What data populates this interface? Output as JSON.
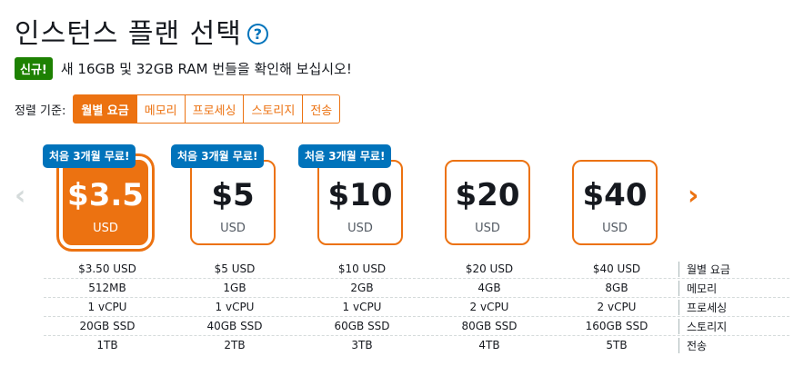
{
  "header": {
    "title": "인스턴스 플랜 선택",
    "help_icon": "?"
  },
  "notice": {
    "badge": "신규!",
    "text": "새 16GB 및 32GB RAM 번들을 확인해 보십시오!"
  },
  "sort": {
    "label": "정렬 기준:",
    "options": [
      "월별 요금",
      "메모리",
      "프로세싱",
      "스토리지",
      "전송"
    ],
    "selected": "월별 요금"
  },
  "nav": {
    "prev_icon": "chevron-left-icon",
    "next_icon": "chevron-right-icon",
    "prev_glyph": "‹",
    "next_glyph": "›"
  },
  "plans": [
    {
      "price": "$3.5",
      "currency": "USD",
      "promo": "처음 3개월 무료!",
      "selected": true,
      "specs": [
        "$3.50 USD",
        "512MB",
        "1 vCPU",
        "20GB SSD",
        "1TB"
      ]
    },
    {
      "price": "$5",
      "currency": "USD",
      "promo": "처음 3개월 무료!",
      "selected": false,
      "specs": [
        "$5 USD",
        "1GB",
        "1 vCPU",
        "40GB SSD",
        "2TB"
      ]
    },
    {
      "price": "$10",
      "currency": "USD",
      "promo": "처음 3개월 무료!",
      "selected": false,
      "specs": [
        "$10 USD",
        "2GB",
        "1 vCPU",
        "60GB SSD",
        "3TB"
      ]
    },
    {
      "price": "$20",
      "currency": "USD",
      "promo": "",
      "selected": false,
      "specs": [
        "$20 USD",
        "4GB",
        "2 vCPU",
        "80GB SSD",
        "4TB"
      ]
    },
    {
      "price": "$40",
      "currency": "USD",
      "promo": "",
      "selected": false,
      "specs": [
        "$40 USD",
        "8GB",
        "2 vCPU",
        "160GB SSD",
        "5TB"
      ]
    }
  ],
  "spec_labels": [
    "월별 요금",
    "메모리",
    "프로세싱",
    "스토리지",
    "전송"
  ],
  "colors": {
    "accent": "#ec7211",
    "promo": "#0073bb",
    "new_badge": "#1d8102"
  }
}
